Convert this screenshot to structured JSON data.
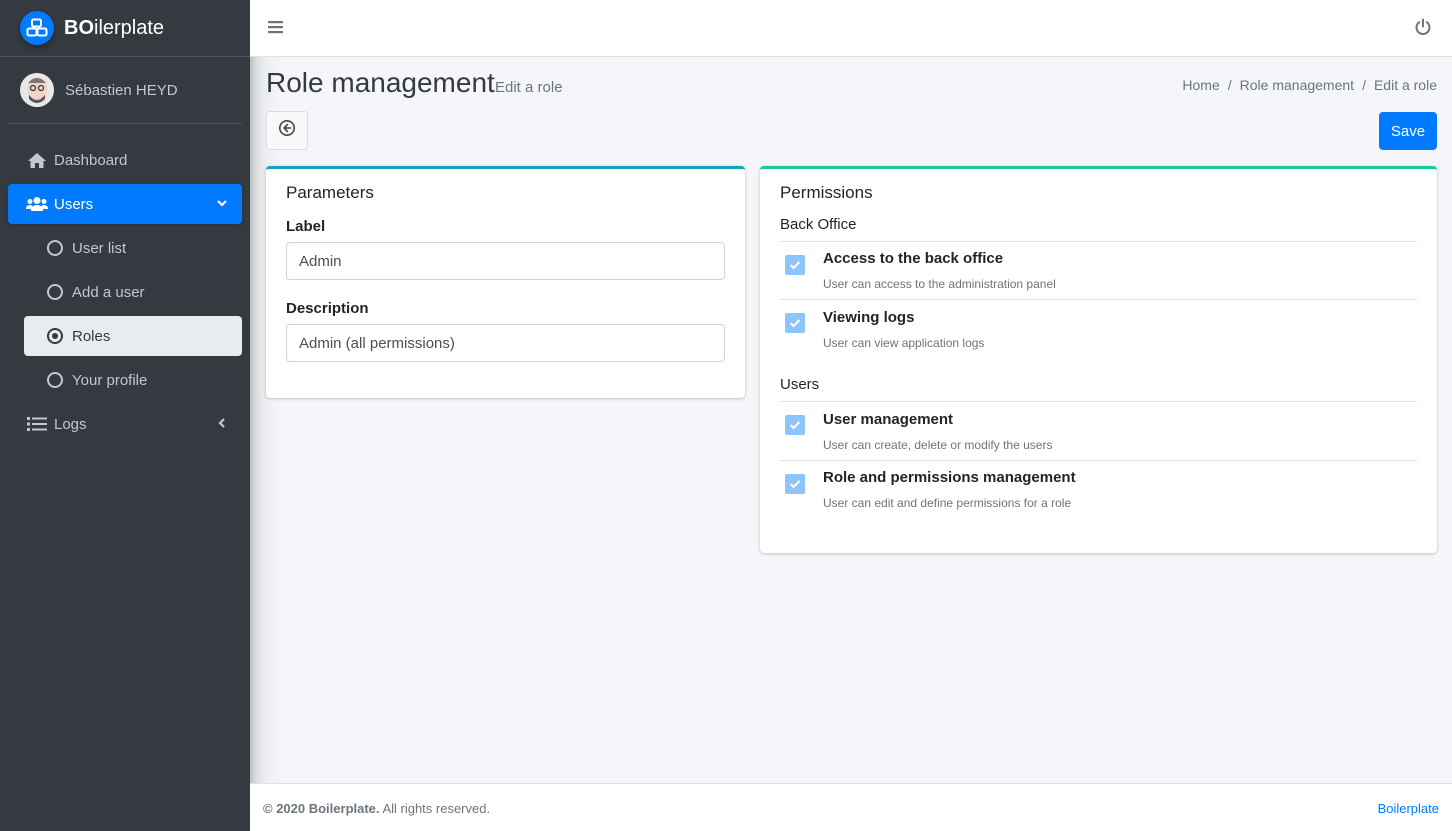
{
  "brand": {
    "prefix": "BO",
    "suffix": "ilerplate"
  },
  "user": {
    "name": "Sébastien HEYD"
  },
  "sidebar": {
    "items": [
      {
        "label": "Dashboard",
        "icon": "home-icon"
      },
      {
        "label": "Users",
        "icon": "users-icon",
        "expanded": true
      },
      {
        "label": "User list",
        "icon": "circle-icon"
      },
      {
        "label": "Add a user",
        "icon": "circle-icon"
      },
      {
        "label": "Roles",
        "icon": "dot-circle-icon",
        "selected": true
      },
      {
        "label": "Your profile",
        "icon": "circle-icon"
      },
      {
        "label": "Logs",
        "icon": "list-icon"
      }
    ]
  },
  "header": {
    "title": "Role management",
    "subtitle": "Edit a role",
    "breadcrumb": [
      "Home",
      "Role management",
      "Edit a role"
    ],
    "save_label": "Save"
  },
  "params": {
    "title": "Parameters",
    "label_label": "Label",
    "label_value": "Admin",
    "description_label": "Description",
    "description_value": "Admin (all permissions)"
  },
  "permissions": {
    "title": "Permissions",
    "sections": [
      {
        "name": "Back Office",
        "items": [
          {
            "title": "Access to the back office",
            "desc": "User can access to the administration panel",
            "checked": true
          },
          {
            "title": "Viewing logs",
            "desc": "User can view application logs",
            "checked": true
          }
        ]
      },
      {
        "name": "Users",
        "items": [
          {
            "title": "User management",
            "desc": "User can create, delete or modify the users",
            "checked": true
          },
          {
            "title": "Role and permissions management",
            "desc": "User can edit and define permissions for a role",
            "checked": true
          }
        ]
      }
    ]
  },
  "footer": {
    "copyright": "© 2020 Boilerplate.",
    "rights": "All rights reserved.",
    "link": "Boilerplate"
  },
  "colors": {
    "primary": "#007bff",
    "sidebar": "#343a40",
    "params_accent": "#17a2b8",
    "perms_accent": "#20c997"
  }
}
